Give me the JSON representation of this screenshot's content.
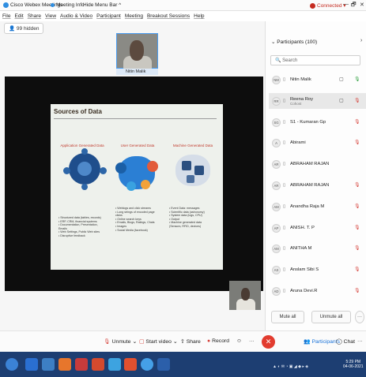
{
  "titlebar": {
    "app_name": "Cisco Webex Meetings",
    "meeting_info": "Meeting Info",
    "hide_menu": "Hide Menu Bar ^",
    "connection_status": "Connected ▾",
    "minimize": "—",
    "maximize": "🗗",
    "close": "✕"
  },
  "menu": [
    "File",
    "Edit",
    "Share",
    "View",
    "Audio & Video",
    "Participant",
    "Meeting",
    "Breakout Sessions",
    "Help"
  ],
  "stage": {
    "hidden_button": "99 hidden",
    "top_tile_name": "Nitin Malik"
  },
  "slide": {
    "title": "Sources of Data",
    "columns": [
      {
        "title": "Application Generated Data",
        "bullets": "• Structured data (tables, records)\n• ERP, CRM, financial systems\n• Documentation, Presentation, Emails\n• Web Settings, Public Web sites\n• Disruptive feedback"
      },
      {
        "title": "User Generated Data",
        "bullets": "• Weblogs and click streams\n• Long strings of encoded page clicks\n• Online search keys\n• Emails, Blogs, Ratings, Chats\n• Images\n• Social Media (facebook)"
      },
      {
        "title": "Machine Generated Data",
        "bullets": "• Event Data: messages\n• Scientific data (astronomy)\n• System data (logs, CPU)\n• Output\n• Machine generated data\n  (Sensors, RFID, devices)"
      }
    ]
  },
  "panel": {
    "title": "Participants (100)",
    "close": "›",
    "search_placeholder": "Search",
    "participants": [
      {
        "initials": "NM",
        "name": "Nitin Malik",
        "sub": "",
        "selected": false,
        "mute_color": "#2a9d3a"
      },
      {
        "initials": "RR",
        "name": "Reena Roy",
        "sub": "Cohost",
        "selected": true,
        "mute_color": "#d5413a"
      },
      {
        "initials": "SG",
        "name": "S1 - Kumaran Gp",
        "sub": "",
        "selected": false,
        "mute_color": "#d5413a"
      },
      {
        "initials": "A",
        "name": "Abirami",
        "sub": "",
        "selected": false,
        "mute_color": "#d5413a"
      },
      {
        "initials": "AR",
        "name": "ABRAHAM RAJAN",
        "sub": "",
        "selected": false,
        "mute_color": ""
      },
      {
        "initials": "AR",
        "name": "ABRAHAM RAJAN",
        "sub": "",
        "selected": false,
        "mute_color": "#d5413a"
      },
      {
        "initials": "AM",
        "name": "Anandha Raja M",
        "sub": "",
        "selected": false,
        "mute_color": "#d5413a"
      },
      {
        "initials": "AP",
        "name": "ANISH. T. P",
        "sub": "",
        "selected": false,
        "mute_color": "#d5413a"
      },
      {
        "initials": "AM",
        "name": "ANITHA M",
        "sub": "",
        "selected": false,
        "mute_color": "#d5413a"
      },
      {
        "initials": "AS",
        "name": "Anslam Sibi S",
        "sub": "",
        "selected": false,
        "mute_color": "#d5413a"
      },
      {
        "initials": "AD",
        "name": "Aruna Devi.R",
        "sub": "",
        "selected": false,
        "mute_color": "#d5413a"
      }
    ],
    "mute_all": "Mute all",
    "unmute_all": "Unmute all",
    "more": "···"
  },
  "controls": {
    "unmute": "Unmute",
    "start_video": "Start video",
    "share": "Share",
    "record": "Record",
    "participants": "Participants",
    "chat": "Chat",
    "more": "···",
    "end": "✕"
  },
  "taskbar": {
    "time": "5:29 PM",
    "date": "04-06-2021"
  }
}
